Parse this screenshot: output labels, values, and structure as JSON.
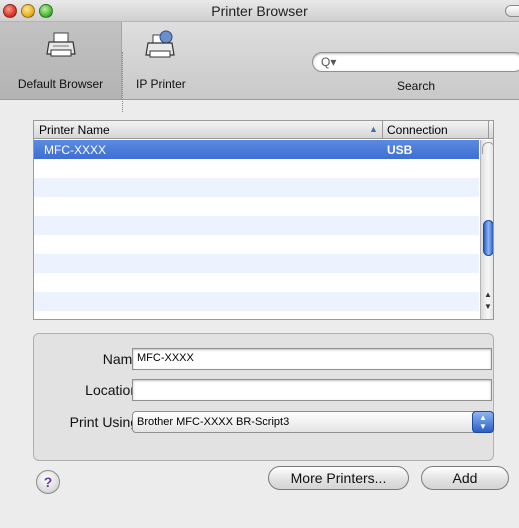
{
  "window": {
    "title": "Printer Browser"
  },
  "toolbar": {
    "default_browser_label": "Default Browser",
    "ip_printer_label": "IP Printer",
    "search_label": "Search",
    "search_placeholder": "",
    "search_glyph": "Q▾"
  },
  "table": {
    "headers": {
      "name": "Printer Name",
      "connection": "Connection"
    },
    "rows": [
      {
        "name": "MFC-XXXX",
        "connection": "USB",
        "selected": true
      }
    ]
  },
  "info": {
    "name_label": "Name:",
    "name_value": "MFC-XXXX",
    "location_label": "Location:",
    "location_value": "",
    "print_using_label": "Print Using:",
    "print_using_value": "Brother MFC-XXXX BR-Script3"
  },
  "buttons": {
    "help": "?",
    "more_printers": "More Printers...",
    "add": "Add"
  },
  "colors": {
    "selection": "#3e6fd3",
    "row_alt": "#edf3fe",
    "scroll_thumb": "#2a5fc4"
  }
}
